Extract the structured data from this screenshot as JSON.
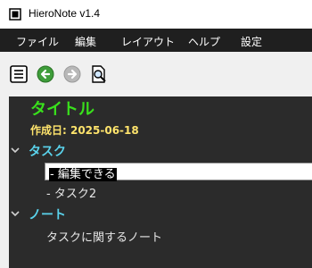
{
  "window": {
    "title": "HieroNote v1.4"
  },
  "menu": [
    "ファイル",
    "編集",
    "レイアウト",
    "ヘルプ",
    "設定"
  ],
  "toolbar": {
    "buttons": [
      {
        "icon": "list-icon"
      },
      {
        "icon": "back-arrow-icon"
      },
      {
        "icon": "forward-arrow-icon"
      },
      {
        "icon": "preview-search-icon"
      }
    ]
  },
  "document": {
    "title": "タイトル",
    "created": "作成日: 2025-06-18",
    "sections": [
      {
        "heading": "タスク",
        "items": [
          {
            "prefix": "- ",
            "text": "編集できる",
            "editing": true
          },
          {
            "prefix": "",
            "text": "- タスク2",
            "editing": false
          }
        ]
      },
      {
        "heading": "ノート",
        "body": "タスクに関するノート"
      }
    ]
  },
  "colors": {
    "title": "#39e01c",
    "date": "#ffe46c",
    "section": "#5ad3ec",
    "background": "#2b2b2b"
  }
}
